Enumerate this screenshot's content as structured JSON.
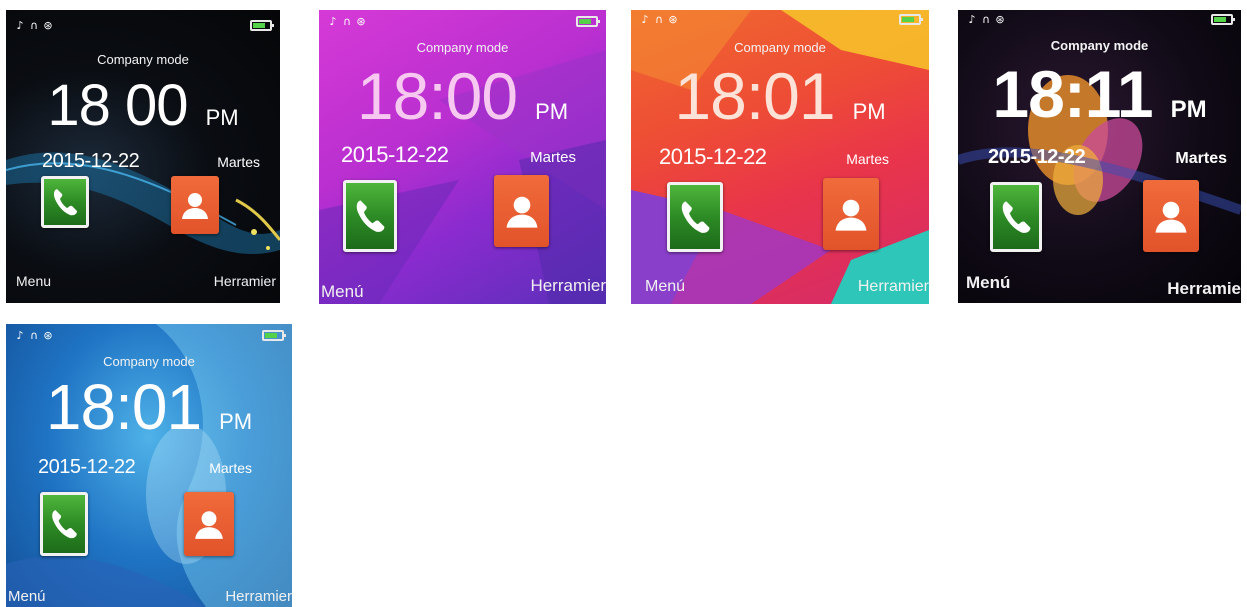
{
  "screens": [
    {
      "status_icons": [
        "music-note-icon",
        "headphones-icon",
        "bluetooth-icon"
      ],
      "mode": "Company mode",
      "time": "18 00",
      "ampm": "PM",
      "date": "2015-12-22",
      "weekday": "Martes",
      "left_softkey": "Menu",
      "right_softkey": "Herramier",
      "theme": "black-wave"
    },
    {
      "status_icons": [
        "music-note-icon",
        "headphones-icon",
        "bluetooth-icon"
      ],
      "mode": "Company mode",
      "time": "18:00",
      "ampm": "PM",
      "date": "2015-12-22",
      "weekday": "Martes",
      "left_softkey": "Menú",
      "right_softkey": "Herramier",
      "theme": "magenta-purple"
    },
    {
      "status_icons": [
        "music-note-icon",
        "headphones-icon",
        "bluetooth-icon"
      ],
      "mode": "Company mode",
      "time": "18:01",
      "ampm": "PM",
      "date": "2015-12-22",
      "weekday": "Martes",
      "left_softkey": "Menú",
      "right_softkey": "Herramier",
      "theme": "red-orange"
    },
    {
      "status_icons": [
        "music-note-icon",
        "headphones-icon",
        "bluetooth-icon"
      ],
      "mode": "Company mode",
      "time": "18:11",
      "ampm": "PM",
      "date": "2015-12-22",
      "weekday": "Martes",
      "left_softkey": "Menú",
      "right_softkey": "Herramie",
      "theme": "dark-flower"
    },
    {
      "status_icons": [
        "music-note-icon",
        "headphones-icon",
        "bluetooth-icon"
      ],
      "mode": "Company mode",
      "time": "18:01",
      "ampm": "PM",
      "date": "2015-12-22",
      "weekday": "Martes",
      "left_softkey": "Menú",
      "right_softkey": "Herramier",
      "theme": "blue-water"
    }
  ],
  "colors": {
    "phone_app": "#2d8b25",
    "contacts_app": "#e2532a",
    "battery_fill": "#56d24a"
  }
}
